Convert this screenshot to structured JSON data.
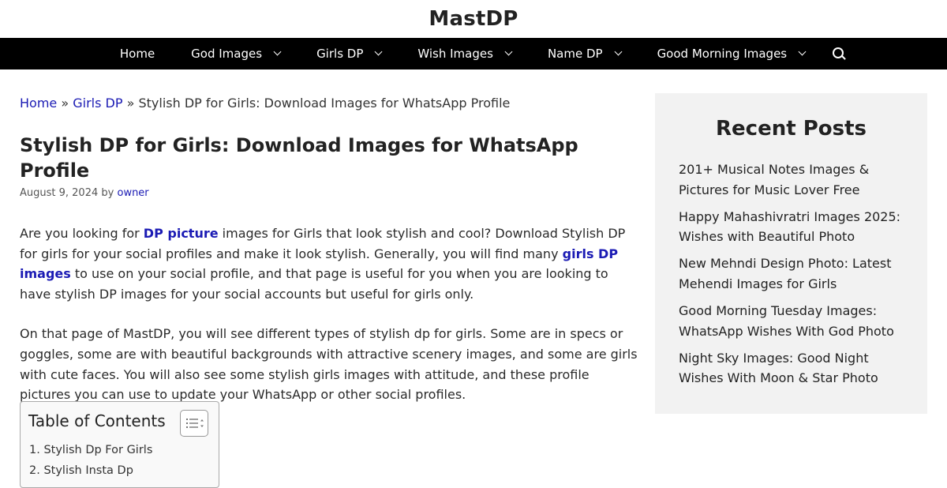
{
  "site": {
    "title": "MastDP"
  },
  "nav": {
    "items": [
      {
        "label": "Home",
        "dropdown": false
      },
      {
        "label": "God Images",
        "dropdown": true
      },
      {
        "label": "Girls DP",
        "dropdown": true
      },
      {
        "label": "Wish Images",
        "dropdown": true
      },
      {
        "label": "Name DP",
        "dropdown": true
      },
      {
        "label": "Good Morning Images",
        "dropdown": true
      }
    ]
  },
  "breadcrumb": {
    "home": "Home",
    "category": "Girls DP",
    "separator": "»",
    "current": "Stylish DP for Girls: Download Images for WhatsApp Profile"
  },
  "article": {
    "title": "Stylish DP for Girls: Download Images for WhatsApp Profile",
    "date": "August 9, 2024",
    "by": "by",
    "author": "owner",
    "p1": {
      "t1": "Are you looking for ",
      "link1": "DP picture",
      "t2": " images for Girls that look stylish and cool? Download Stylish DP for girls for your social profiles and make it look stylish. Generally, you will find many ",
      "link2": "girls DP images",
      "t3": " to use on your social profile, and that page is useful for you when you are looking to have stylish DP images for your social accounts but useful for girls only."
    },
    "p2": "On that page of MastDP, you will see different types of stylish dp for girls. Some are in specs or goggles, some are with beautiful backgrounds with attractive scenery images, and some are girls with cute faces. You will also see some stylish girls images with attitude, and these profile pictures you can use to update your WhatsApp or other social profiles."
  },
  "toc": {
    "title": "Table of Contents",
    "items": [
      "1. Stylish Dp For Girls",
      "2. Stylish Insta Dp"
    ]
  },
  "sidebar": {
    "heading": "Recent Posts",
    "posts": [
      "201+ Musical Notes Images & Pictures for Music Lover Free",
      "Happy Mahashivratri Images 2025: Wishes with Beautiful Photo",
      "New Mehndi Design Photo: Latest Mehendi Images for Girls",
      "Good Morning Tuesday Images: WhatsApp Wishes With God Photo",
      "Night Sky Images: Good Night Wishes With Moon & Star Photo"
    ]
  },
  "icons": {
    "search": "search-icon",
    "toc_toggle": "list-toggle-icon",
    "dropdown": "chevron-down-icon"
  },
  "colors": {
    "nav_bg": "#000000",
    "link": "#1b1bb4",
    "sidebar_bg": "#f2f2f2"
  }
}
